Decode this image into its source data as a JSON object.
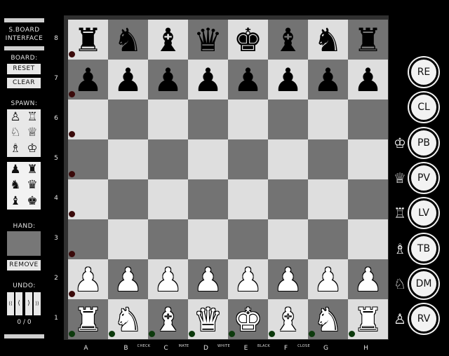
{
  "app": {
    "title_line1": "S.BOARD",
    "title_line2": "INTERFACE"
  },
  "left": {
    "board_label": "BOARD:",
    "reset_label": "RESET",
    "clear_label": "CLEAR",
    "spawn_label": "SPAWN:",
    "hand_label": "HAND:",
    "remove_label": "REMOVE",
    "undo_label": "UNDO:",
    "undo_buttons": [
      "⟨⟨",
      "⟨",
      "⟩",
      "⟩⟩"
    ],
    "undo_count": "0 / 0",
    "spawn_white": [
      "♙",
      "♖",
      "♘",
      "♕",
      "♗",
      "♔"
    ],
    "spawn_black": [
      "♟",
      "♜",
      "♞",
      "♛",
      "♝",
      "♚"
    ]
  },
  "board": {
    "ranks": [
      "8",
      "7",
      "6",
      "5",
      "4",
      "3",
      "2",
      "1"
    ],
    "files": [
      "A",
      "B",
      "C",
      "D",
      "E",
      "F",
      "G",
      "H"
    ],
    "file_sublabels": [
      "",
      "CHECK",
      "MATE",
      "WHITE",
      "BLACK",
      "CLOSE",
      "",
      ""
    ],
    "position": [
      [
        "♜",
        "♞",
        "♝",
        "♛",
        "♚",
        "♝",
        "♞",
        "♜"
      ],
      [
        "♟",
        "♟",
        "♟",
        "♟",
        "♟",
        "♟",
        "♟",
        "♟"
      ],
      [
        "",
        "",
        "",
        "",
        "",
        "",
        "",
        ""
      ],
      [
        "",
        "",
        "",
        "",
        "",
        "",
        "",
        ""
      ],
      [
        "",
        "",
        "",
        "",
        "",
        "",
        "",
        ""
      ],
      [
        "",
        "",
        "",
        "",
        "",
        "",
        "",
        ""
      ],
      [
        "♙",
        "♙",
        "♙",
        "♙",
        "♙",
        "♙",
        "♙",
        "♙"
      ],
      [
        "♖",
        "♘",
        "♗",
        "♕",
        "♔",
        "♗",
        "♘",
        "♖"
      ]
    ],
    "light_color": "#dedede",
    "dark_color": "#737373"
  },
  "right": {
    "buttons": [
      "RE",
      "CL",
      "PB",
      "PV",
      "LV",
      "TB",
      "DM",
      "RV"
    ],
    "side_icons": [
      "",
      "",
      "♔",
      "♕",
      "♖",
      "♗",
      "♘",
      "♙"
    ]
  }
}
